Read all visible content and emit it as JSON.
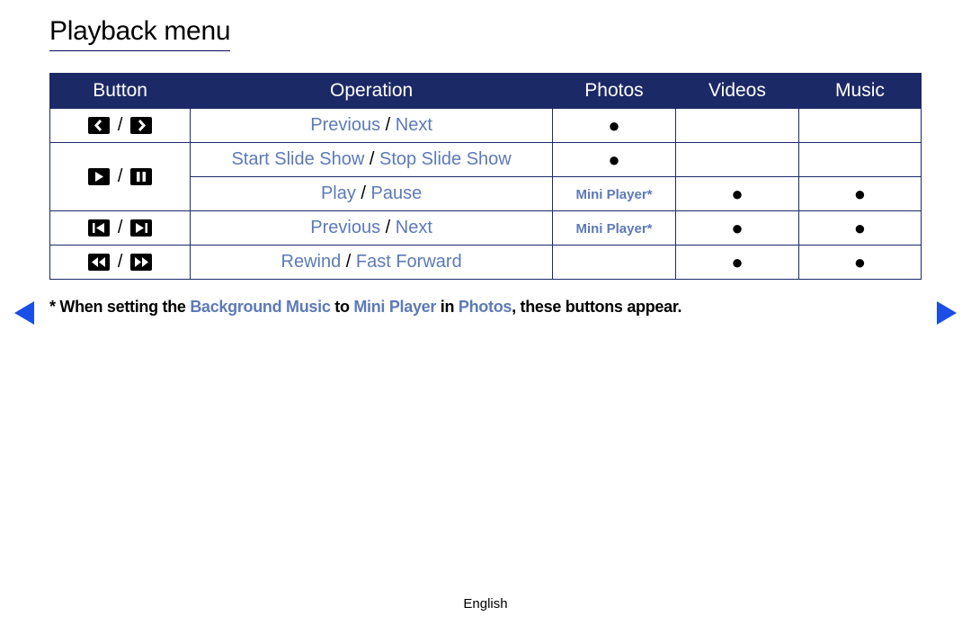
{
  "title": "Playback menu",
  "headers": {
    "button": "Button",
    "operation": "Operation",
    "photos": "Photos",
    "videos": "Videos",
    "music": "Music"
  },
  "rows": {
    "r1": {
      "op_a": "Previous",
      "op_b": "Next",
      "photos": "●",
      "videos": "",
      "music": ""
    },
    "r2": {
      "op_a": "Start Slide Show",
      "op_b": "Stop Slide Show",
      "photos": "●",
      "videos": "",
      "music": ""
    },
    "r3": {
      "op_a": "Play",
      "op_b": "Pause",
      "photos": "Mini Player*",
      "videos": "●",
      "music": "●"
    },
    "r4": {
      "op_a": "Previous",
      "op_b": "Next",
      "photos": "Mini Player*",
      "videos": "●",
      "music": "●"
    },
    "r5": {
      "op_a": "Rewind",
      "op_b": "Fast Forward",
      "photos": "",
      "videos": "●",
      "music": "●"
    }
  },
  "slash": " / ",
  "footnote": {
    "prefix": "* When setting the ",
    "bg": "Background Music",
    "to": " to ",
    "mp": "Mini Player",
    "in": " in ",
    "photos": "Photos",
    "suffix": ", these buttons appear."
  },
  "language": "English"
}
